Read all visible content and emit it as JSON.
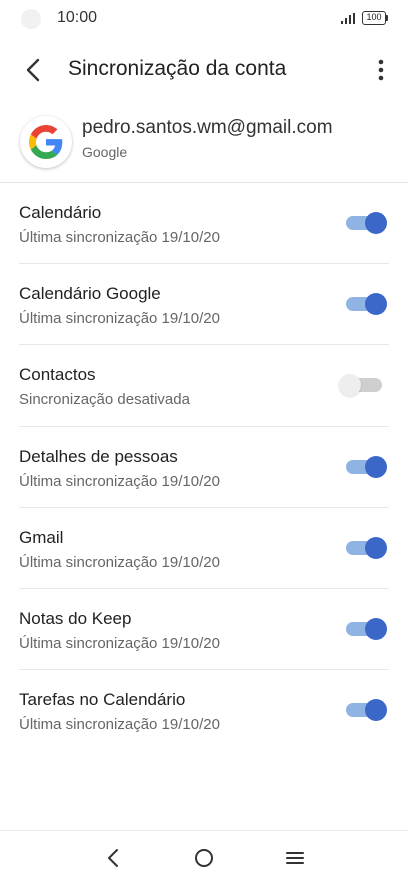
{
  "status_bar": {
    "time": "10:00",
    "battery": "100"
  },
  "app_bar": {
    "title": "Sincronização da conta"
  },
  "account": {
    "email": "pedro.santos.wm@gmail.com",
    "provider": "Google"
  },
  "sync_items": [
    {
      "title": "Calendário",
      "subtitle": "Última sincronização 19/10/20",
      "enabled": true
    },
    {
      "title": "Calendário Google",
      "subtitle": "Última sincronização 19/10/20",
      "enabled": true
    },
    {
      "title": "Contactos",
      "subtitle": "Sincronização desativada",
      "enabled": false
    },
    {
      "title": "Detalhes de pessoas",
      "subtitle": "Última sincronização 19/10/20",
      "enabled": true
    },
    {
      "title": "Gmail",
      "subtitle": "Última sincronização 19/10/20",
      "enabled": true
    },
    {
      "title": "Notas do Keep",
      "subtitle": "Última sincronização 19/10/20",
      "enabled": true
    },
    {
      "title": "Tarefas no Calendário",
      "subtitle": "Última sincronização 19/10/20",
      "enabled": true
    }
  ],
  "colors": {
    "toggle_on_track": "#8fb3e3",
    "toggle_on_knob": "#3a67c8",
    "toggle_off_track": "#cfcfcf",
    "toggle_off_knob": "#eeeeee"
  },
  "icons": {
    "back": "back-arrow-icon",
    "more": "more-vert-icon",
    "logo": "google-logo-icon",
    "nav_back": "nav-back-icon",
    "nav_home": "nav-home-icon",
    "nav_recents": "nav-recents-icon",
    "signal": "signal-icon",
    "battery": "battery-icon"
  }
}
